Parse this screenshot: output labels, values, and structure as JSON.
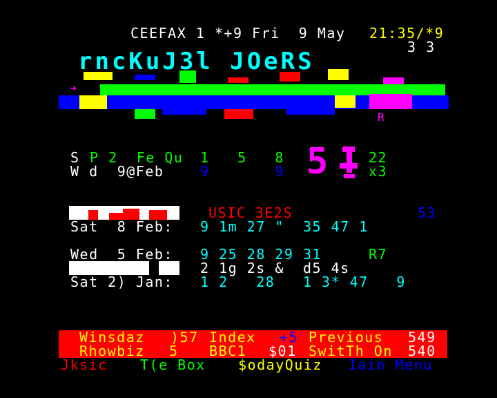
{
  "header": {
    "service": "CEEFAX 1 *+9 Fri  9 May",
    "clock": "21:35/*9",
    "subpage": "3 3"
  },
  "banner": {
    "title": "rncKuJ3l JOeRS",
    "marks": {
      "arrow": "➜",
      "at": "@",
      "w": "W",
      "r": "R"
    }
  },
  "scores": {
    "row1_left": "S",
    "row1_mid": "P 2  Fe Qu",
    "row1_nums": "1   5   8",
    "row2_left": "W d  9@Feb",
    "row2_nums": "9       9",
    "big_number": "5",
    "side_a": "22",
    "side_b": "x3"
  },
  "results": {
    "heading": "USIC 3E2S",
    "heading_num": "53",
    "line1_date": "Sat  8 Feb:",
    "line1_vals": "9 1m 27 \"  35 47 1",
    "line2_date": "Wed  5 Feb:",
    "line2_vals": "9 25 28 29 31",
    "line2_extra": "R7",
    "line3_vals": "2 1g 2s &  d5 4s",
    "line4_date": "Sat 2) Jan:",
    "line4_vals": "1 2   28   1 3* 47   9"
  },
  "footer": {
    "row1": [
      {
        "label": "Winsdaz",
        "num": ")57"
      },
      {
        "label": "Index",
        "num": "+5"
      },
      {
        "label": "Previous",
        "num": "549"
      }
    ],
    "row2": [
      {
        "label": "Rhowbiz",
        "num": "5"
      },
      {
        "label": "BBC1",
        "num": "$01"
      },
      {
        "label": "SwitTh On",
        "num": "540"
      }
    ],
    "fastext": [
      {
        "label": "Jksic",
        "color": "#ff0000"
      },
      {
        "label": "T(e Box",
        "color": "#00ff00"
      },
      {
        "label": "$odayQuiz",
        "color": "#ffff00"
      },
      {
        "label": "Iain Menu",
        "color": "#0000ff"
      }
    ]
  },
  "colors": {
    "background": "#000000",
    "white": "#ffffff",
    "yellow": "#ffff00",
    "cyan": "#00ffff",
    "green": "#00ff00",
    "magenta": "#ff00ff",
    "red": "#ff0000",
    "blue": "#0000ff"
  }
}
